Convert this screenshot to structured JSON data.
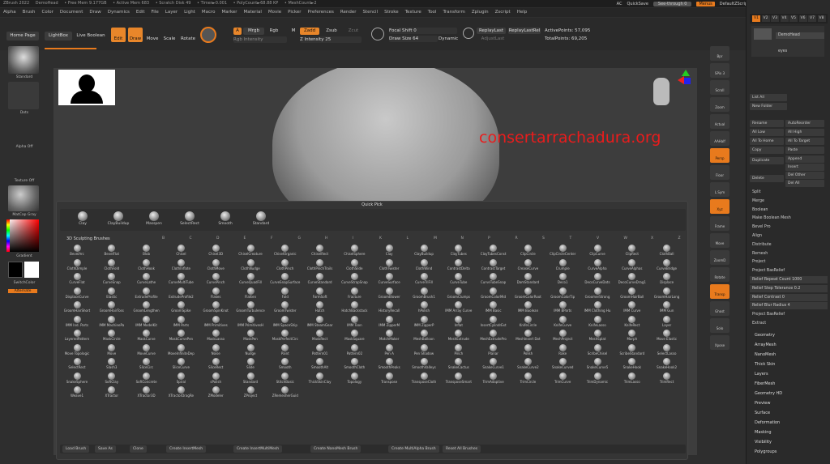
{
  "titlebar": {
    "app": "ZBrush 2022",
    "doc": "DemoHead",
    "stats": [
      "• Free Mem 9.177GB",
      "• Active Mem 683",
      "• Scratch Disk 49",
      "• Timer►0.001",
      "• PolyCount►68.88 KP",
      "• MeshCount►2"
    ],
    "ac": "AC",
    "quicksave": "QuickSave",
    "seethrough": "See-through  0",
    "menus": "Menus",
    "script": "DefaultZScript"
  },
  "menubar": [
    "Alpha",
    "Brush",
    "Color",
    "Document",
    "Draw",
    "Dynamics",
    "Edit",
    "File",
    "Layer",
    "Light",
    "Macro",
    "Marker",
    "Material",
    "Movie",
    "Picker",
    "Preferences",
    "Render",
    "Stencil",
    "Stroke",
    "Texture",
    "Tool",
    "Transform",
    "Zplugin",
    "Zscript",
    "Help"
  ],
  "toolbar": {
    "home": "Home Page",
    "lightbox": "LightBox",
    "liveboolean": "Live Boolean",
    "edit": "Edit",
    "draw": "Draw",
    "move": "Move",
    "scale": "Scale",
    "rotate": "Rotate",
    "a": "A",
    "mrgb": "Mrgb",
    "rgb": "Rgb",
    "m": "M",
    "zadd": "Zadd",
    "zsub": "Zsub",
    "zcut": "Zcut",
    "rgbint": "Rgb Intensity",
    "zint": "Z Intensity 25",
    "focal": "Focal Shift 0",
    "drawsize": "Draw Size 64",
    "dynamic": "Dynamic",
    "replaylast": "ReplayLast",
    "replaylastrel": "ReplayLastRel",
    "adjustlast": "AdjustLast",
    "activepoints": "ActivePoints: 57,095",
    "totalpoints": "TotalPoints: 69,205"
  },
  "left": {
    "standard": "Standard",
    "dots": "Dots",
    "alphaoff": "Alpha Off",
    "textureoff": "Texture Off",
    "matcap": "MatCap Gray",
    "gradient": "Gradient",
    "switchcolor": "SwitchColor",
    "alternate": "Alternate"
  },
  "watermark": "consertarrachadura.org",
  "quickpick": {
    "title": "Quick Pick",
    "items": [
      "Clay",
      "ClayBuildup",
      "Masspen",
      "SelectRect",
      "Smooth",
      "Standard"
    ]
  },
  "brushes_title": "3D Sculpting Brushes",
  "letters": [
    "B",
    "C",
    "D",
    "E",
    "F",
    "G",
    "H",
    "I",
    "K",
    "L",
    "M",
    "N",
    "P",
    "R",
    "S",
    "T",
    "V",
    "W",
    "X",
    "Z"
  ],
  "brushes": [
    "BevelArc",
    "BevelFlat",
    "Blob",
    "Chisel",
    "Chisel3D",
    "ChiselCreature",
    "ChiselOrganic",
    "ChiselRect",
    "ChiselSphere",
    "Clay",
    "ClayBuildup",
    "ClayTubes",
    "ClayTubesConst",
    "ClipCircle",
    "ClipCircleCenter",
    "ClipCurve",
    "ClipRect",
    "ClothBall",
    "ClothDimple",
    "ClothFold",
    "ClothHook",
    "ClothInflate",
    "ClothMove",
    "ClothNudge",
    "ClothPinch",
    "ClothPinchTrails",
    "ClothSlide",
    "ClothTwister",
    "ClothWind",
    "ContrastDelta",
    "ContrastTarget",
    "CreaseCurve",
    "Crumple",
    "CurveAlpha",
    "CurveAlphas",
    "CurveBridge",
    "CurveFlat",
    "CurveSnap",
    "CurveLathe",
    "CurveMultiTube",
    "CurvePinch",
    "CurveQuadFill",
    "CurveSnapSurface",
    "CurveStandard",
    "CurveStrapSnap",
    "CurveSurface",
    "CurveTriFill",
    "CurveTube",
    "CurveTubeSnap",
    "DamStandard",
    "Deco1",
    "DecoCurveDots",
    "DecoCurveDrag1",
    "Displace",
    "DisplaceCurve",
    "Elastic",
    "ExtrudeProfile",
    "ExtrudeProfile2",
    "Flakes",
    "Flatten",
    "Fold",
    "FormSoft",
    "Fracture",
    "GroomBlower",
    "GroomBrush1",
    "GroomClumps",
    "GroomColorMid",
    "GroomColorRoot",
    "GroomColorTip",
    "GroomerStrong",
    "GroomHairBall",
    "GroomHairLong",
    "GroomHairShort",
    "GroomHairToss",
    "GroomLengthen",
    "GroomSpike",
    "GroomSpinKnot",
    "GroomTurbulence",
    "GroomTwister",
    "Hatch",
    "HatchBackstack",
    "HistoryRecall",
    "hPolish",
    "IMM Array Curve",
    "IMM Basic",
    "IMM Boolean",
    "IMM BParts",
    "IMM Clothing Hu",
    "IMM Curve",
    "IMM Gun",
    "IMM Ind. Parts",
    "IMM MachinePa",
    "IMM ModelKit",
    "IMM Parts",
    "IMM Primitives",
    "IMM PrimitivesH",
    "IMM SpaceShip",
    "IMM SteamGear",
    "IMM Toon",
    "IMM ZipperM",
    "IMM ZipperP",
    "Inflat",
    "InsertCylindrExt",
    "KnifeCircle",
    "KnifeCurve",
    "KnifeLasso",
    "KnifeRect",
    "Layer",
    "LayeredPattern",
    "MaskCircle",
    "MaskCurve",
    "MaskCurvePen",
    "MaskLasso",
    "MaskPen",
    "MaskPerfectCirc",
    "MaskRect",
    "MaskSquare",
    "MatchMaker",
    "MeshBalloon",
    "MeshExtrude",
    "MeshExtrudePro",
    "MeshInsert Dot",
    "MeshProject",
    "MeshSplat",
    "Morph",
    "Move Elastic",
    "Move Topologic",
    "Move",
    "MoveCurve",
    "MoveInfiniteDep",
    "Noise",
    "Nudge",
    "Paint",
    "Pattern01",
    "Pattern02",
    "Pen A",
    "Pen Shadow",
    "Pinch",
    "Planar",
    "Polish",
    "Rake",
    "ScribeChisel",
    "ScribeStandard",
    "SelectLasso",
    "SelectRect",
    "Slash3",
    "SliceCirc",
    "SliceCurve",
    "SliceRect",
    "Slide",
    "Smooth",
    "SmoothAlt",
    "SmoothCloth",
    "SmoothPeaks",
    "SmoothValleys",
    "SnakeCactus",
    "SnakeCurve1",
    "SnakeCurve2",
    "SnakeCurved",
    "SnakeCurve5",
    "SnakeHook",
    "SnakeHook2",
    "SnakeSphere",
    "SoftClay",
    "SoftConcrete",
    "Spiral",
    "sPolish",
    "Standard",
    "StitchBasic",
    "ThickSkinClay",
    "Topology",
    "Transpose",
    "TransposeCloth",
    "TransposeSmart",
    "TrimAdaptive",
    "TrimCircle",
    "TrimCurve",
    "TrimDynamic",
    "TrimLasso",
    "TrimRect",
    "Weave1",
    "XTractor",
    "XTractor3D",
    "XTractorDragRe",
    "ZModeler",
    "ZProject",
    "ZRemesherGuid"
  ],
  "bottom": [
    "Load Brush",
    "Save As",
    "Clone",
    "Create InsertMesh",
    "Create InsertMultiMesh",
    "Create NanoMesh Brush",
    "Create MultiAlpha Brush",
    "Reset All Brushes"
  ],
  "righttray": [
    "Bpr",
    "SPix 3",
    "Scroll",
    "Zoom",
    "Actual",
    "AAHalf",
    "Persp",
    "Floor",
    "L.Sym",
    "Xyz",
    "Frame",
    "Move",
    "ZoomD",
    "Rotate",
    "Transp",
    "Ghost",
    "Solo",
    "Xpose"
  ],
  "rpanel": {
    "tabs": [
      "V1",
      "V2",
      "V3",
      "V4",
      "V5",
      "V6",
      "V7",
      "V8"
    ],
    "subtools": [
      "DemoHead",
      "eyes"
    ],
    "actions": [
      "List All",
      "New Folder",
      "Rename",
      "AutoReorder",
      "All Low",
      "All High",
      "All To Home",
      "All To Target",
      "Copy",
      "Paste",
      "Duplicate",
      "Append",
      "Insert",
      "Delete",
      "Del Other",
      "Del All"
    ],
    "list": [
      "Split",
      "Merge",
      "Boolean",
      "Make Boolean Mesh",
      "Bevel Pro",
      "Align",
      "Distribute",
      "Remesh",
      "Project",
      "Project BasRelief",
      "Relief Repeat Count 1000",
      "Relief Step Tolerance 0.2",
      "Relief Contrast 0",
      "Relief Blur Radius 4",
      "Project BasRelief",
      "Extract"
    ],
    "sections": [
      "Geometry",
      "ArrayMesh",
      "NanoMesh",
      "Thick Skin",
      "Layers",
      "FiberMesh",
      "Geometry HD",
      "Preview",
      "Surface",
      "Deformation",
      "Masking",
      "Visibility",
      "Polygroups"
    ]
  }
}
